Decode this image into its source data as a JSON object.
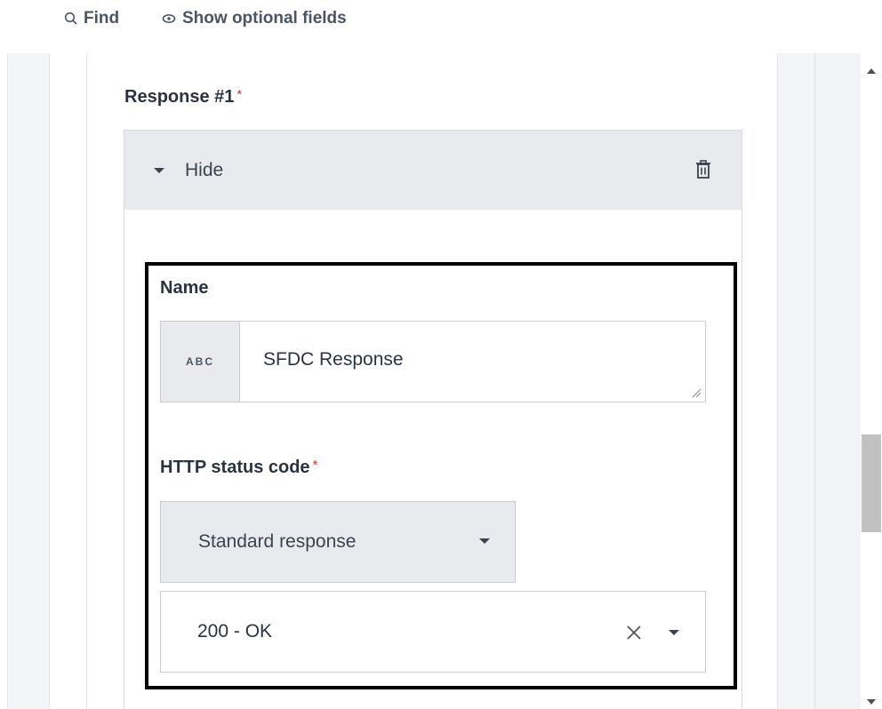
{
  "toolbar": {
    "find_label": "Find",
    "optional_label": "Show optional fields"
  },
  "response": {
    "label": "Response #1",
    "required_mark": "*",
    "toggle_label": "Hide"
  },
  "name_field": {
    "label": "Name",
    "type_tag": "ABC",
    "value": "SFDC Response"
  },
  "status_field": {
    "label": "HTTP status code",
    "required_mark": "*",
    "mode_select": "Standard response",
    "value": "200 - OK"
  },
  "colors": {
    "required": "#d9382b",
    "highlight_border": "#000000",
    "panel_gray": "#e8eaed"
  },
  "icons": [
    "search-icon",
    "eye-icon",
    "triangle-down-icon",
    "trash-icon",
    "resize-icon",
    "close-icon",
    "chevron-down-icon"
  ]
}
